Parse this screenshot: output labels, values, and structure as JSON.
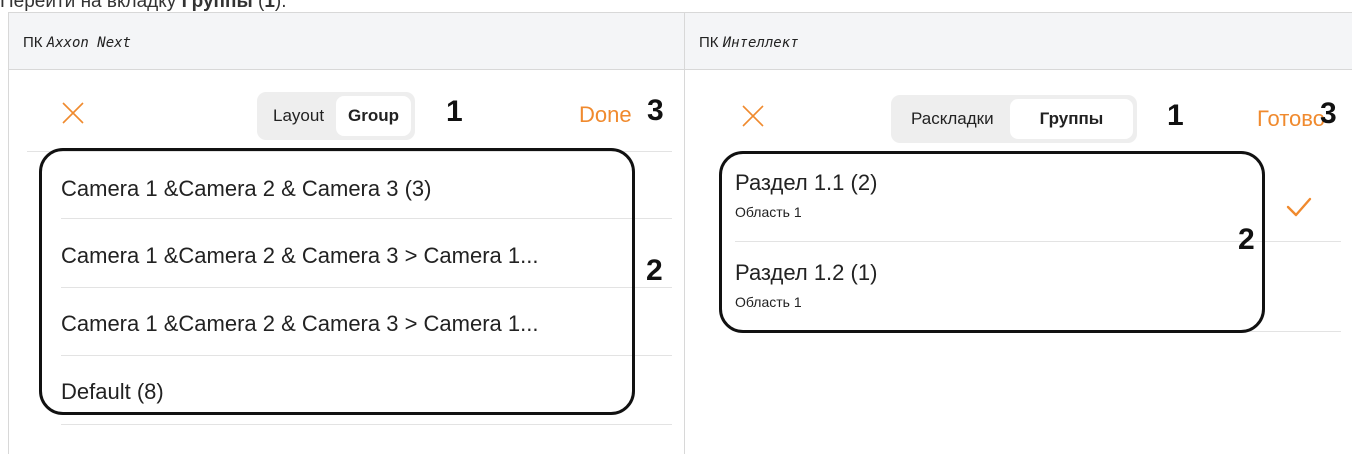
{
  "caption": {
    "text": "Перейти на вкладку ",
    "bold": "Группы",
    "suffix_open": " (",
    "suffix_num": "1",
    "suffix_close": ")."
  },
  "left": {
    "header_prefix": "ПК ",
    "header_product": "Axxon Next",
    "close_icon": "close-icon",
    "tabs": [
      {
        "label": "Layout",
        "active": false
      },
      {
        "label": "Group",
        "active": true
      }
    ],
    "done_label": "Done",
    "callouts": {
      "tabs": "1",
      "list": "2",
      "done": "3"
    },
    "rows": [
      {
        "title": "Camera 1 &Camera 2 & Camera 3 (3)"
      },
      {
        "title": "Camera 1 &Camera 2 & Camera 3 > Camera 1..."
      },
      {
        "title": "Camera 1 &Camera 2 & Camera 3 > Camera 1..."
      },
      {
        "title": "Default (8)"
      }
    ]
  },
  "right": {
    "header_prefix": "ПК ",
    "header_product": "Интеллект",
    "close_icon": "close-icon",
    "tabs": [
      {
        "label": "Раскладки",
        "active": false
      },
      {
        "label": "Группы",
        "active": true
      }
    ],
    "done_label": "Готово",
    "callouts": {
      "tabs": "1",
      "list": "2",
      "done": "3"
    },
    "rows": [
      {
        "title": "Раздел 1.1 (2)",
        "subtitle": "Область 1",
        "checked": true
      },
      {
        "title": "Раздел 1.2 (1)",
        "subtitle": "Область 1",
        "checked": false
      }
    ],
    "check_icon": "checkmark-icon"
  },
  "colors": {
    "accent": "#f08a2e",
    "frame": "#111111",
    "header_bg": "#f4f5f7",
    "segmented_bg": "#eeeeee"
  }
}
